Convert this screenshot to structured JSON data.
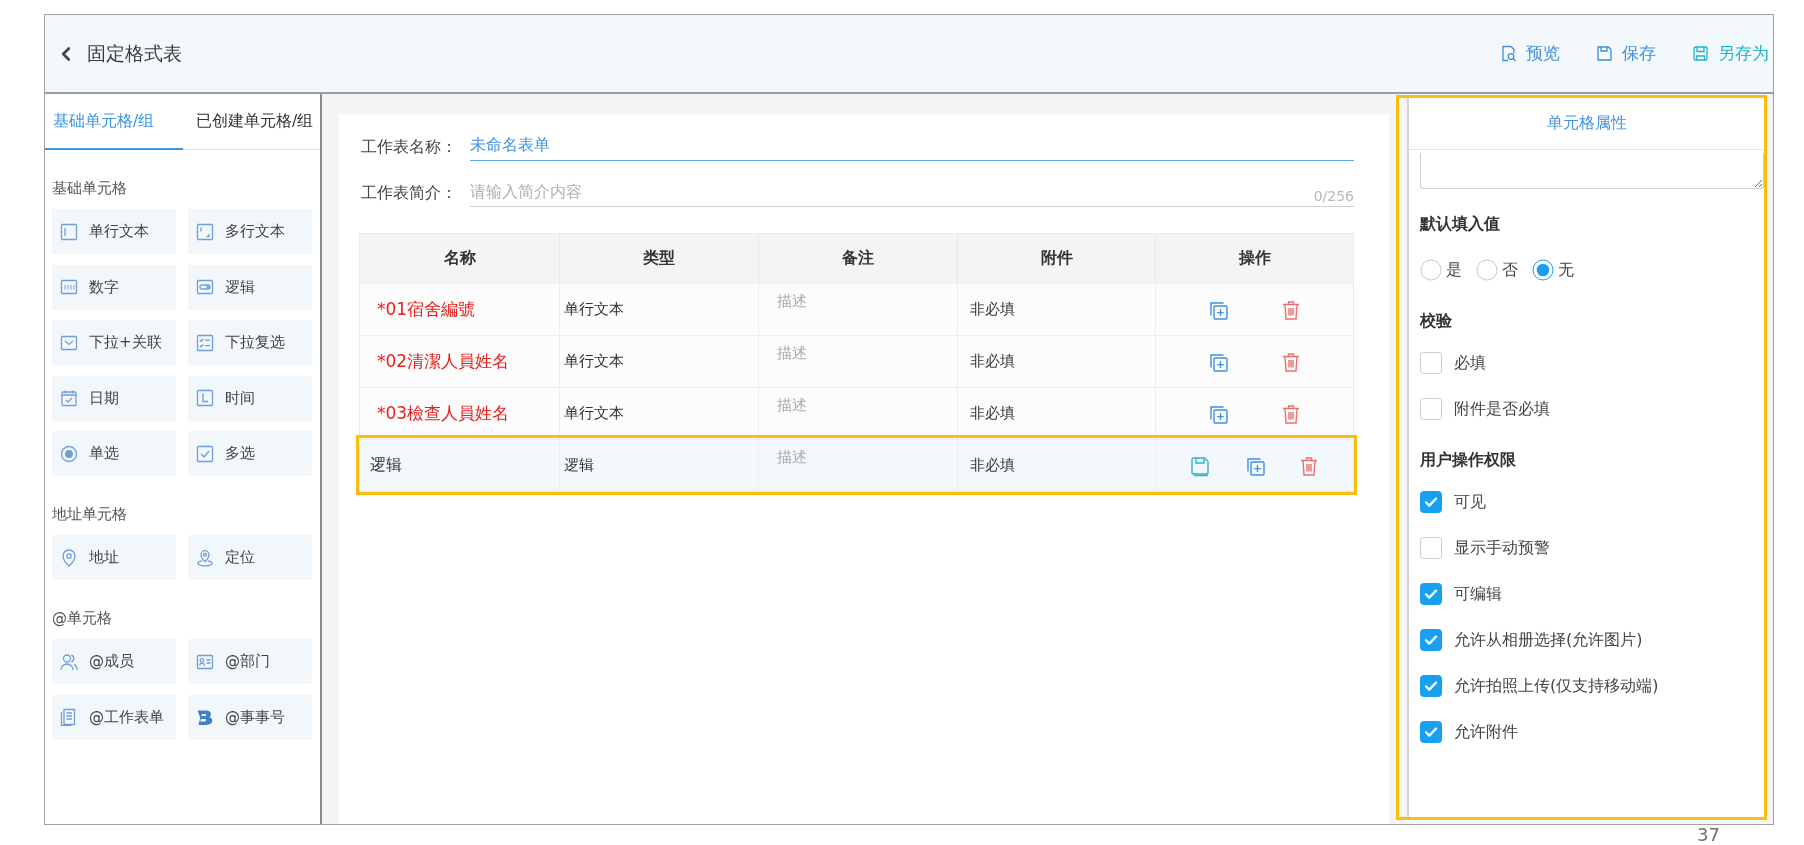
{
  "header": {
    "title": "固定格式表",
    "actions": [
      {
        "kind": "preview",
        "label": "预览",
        "color": "#3f8fd9"
      },
      {
        "kind": "save",
        "label": "保存",
        "color": "#3f8fd9"
      },
      {
        "kind": "saveas",
        "label": "另存为",
        "color": "#1db3c6"
      }
    ]
  },
  "palette": {
    "tabs": [
      {
        "label": "基础单元格/组",
        "selected": true
      },
      {
        "label": "已创建单元格/组",
        "selected": false
      }
    ],
    "groups": [
      {
        "title": "基础单元格",
        "items": [
          {
            "kind": "textline",
            "label": "单行文本"
          },
          {
            "kind": "textarea",
            "label": "多行文本"
          },
          {
            "kind": "number",
            "label": "数字"
          },
          {
            "kind": "boolean",
            "label": "逻辑"
          },
          {
            "kind": "dropdown",
            "label": "下拉+关联"
          },
          {
            "kind": "multiselect",
            "label": "下拉复选"
          },
          {
            "kind": "date",
            "label": "日期"
          },
          {
            "kind": "time",
            "label": "时间"
          },
          {
            "kind": "radio",
            "label": "单选"
          },
          {
            "kind": "checkbox",
            "label": "多选"
          }
        ]
      },
      {
        "title": "地址单元格",
        "items": [
          {
            "kind": "address",
            "label": "地址"
          },
          {
            "kind": "location",
            "label": "定位"
          }
        ]
      },
      {
        "title": "@单元格",
        "items": [
          {
            "kind": "member",
            "label": "@成员"
          },
          {
            "kind": "department",
            "label": "@部门"
          },
          {
            "kind": "worksheet",
            "label": "@工作表单"
          },
          {
            "kind": "logo",
            "label": "@事事号"
          }
        ]
      }
    ]
  },
  "worksheet": {
    "name_label": "工作表名称：",
    "name_value": "未命名表单",
    "intro_label": "工作表简介：",
    "intro_placeholder": "请输入简介内容",
    "intro_counter": "0/256"
  },
  "table": {
    "columns": [
      "名称",
      "类型",
      "备注",
      "附件",
      "操作"
    ],
    "rows": [
      {
        "name": "*01宿舍編號",
        "required": true,
        "type": "单行文本",
        "note_placeholder": "描述",
        "attachment": "非必填",
        "selected": false,
        "highlighted": false
      },
      {
        "name": "*02清潔人員姓名",
        "required": true,
        "type": "单行文本",
        "note_placeholder": "描述",
        "attachment": "非必填",
        "selected": false,
        "highlighted": false
      },
      {
        "name": "*03檢查人員姓名",
        "required": true,
        "type": "单行文本",
        "note_placeholder": "描述",
        "attachment": "非必填",
        "selected": false,
        "highlighted": false
      },
      {
        "name": "逻辑",
        "required": false,
        "type": "逻辑",
        "note_placeholder": "描述",
        "attachment": "非必填",
        "selected": true,
        "highlighted": true
      }
    ]
  },
  "properties": {
    "title": "单元格属性",
    "highlighted": true,
    "sections": [
      {
        "kind": "radio",
        "title": "默认填入值",
        "options": [
          {
            "label": "是",
            "selected": false
          },
          {
            "label": "否",
            "selected": false
          },
          {
            "label": "无",
            "selected": true
          }
        ]
      },
      {
        "kind": "checkbox",
        "title": "校验",
        "options": [
          {
            "label": "必填",
            "checked": false
          },
          {
            "label": "附件是否必填",
            "checked": false
          }
        ]
      },
      {
        "kind": "checkbox",
        "title": "用户操作权限",
        "options": [
          {
            "label": "可见",
            "checked": true
          },
          {
            "label": "显示手动预警",
            "checked": false
          },
          {
            "label": "可编辑",
            "checked": true
          },
          {
            "label": "允许从相册选择(允许图片)",
            "checked": true
          },
          {
            "label": "允许拍照上传(仅支持移动端)",
            "checked": true
          },
          {
            "label": "允许附件",
            "checked": true
          }
        ]
      }
    ]
  },
  "page_number": "37"
}
